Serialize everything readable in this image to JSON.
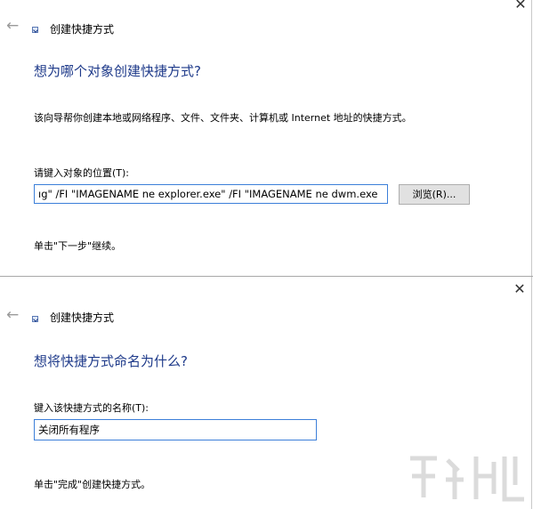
{
  "window1": {
    "close_glyph": "✕",
    "back_glyph": "←",
    "wizard_title": "创建快捷方式",
    "heading": "想为哪个对象创建快捷方式?",
    "description": "该向导帮你创建本地或网络程序、文件、文件夹、计算机或 Internet 地址的快捷方式。",
    "location_label": "请键入对象的位置(T):",
    "location_value": "ıg\" /FI \"IMAGENAME ne explorer.exe\" /FI \"IMAGENAME ne dwm.exe",
    "browse_label": "浏览(R)...",
    "footer": "单击\"下一步\"继续。"
  },
  "window2": {
    "close_glyph": "✕",
    "back_glyph": "←",
    "wizard_title": "创建快捷方式",
    "heading": "想将快捷方式命名为什么?",
    "name_label": "键入该快捷方式的名称(T):",
    "name_value": "关闭所有程序",
    "footer": "单击\"完成\"创建快捷方式。"
  },
  "colors": {
    "heading": "#1e3a8a",
    "focus_border": "#3c7fd9"
  }
}
